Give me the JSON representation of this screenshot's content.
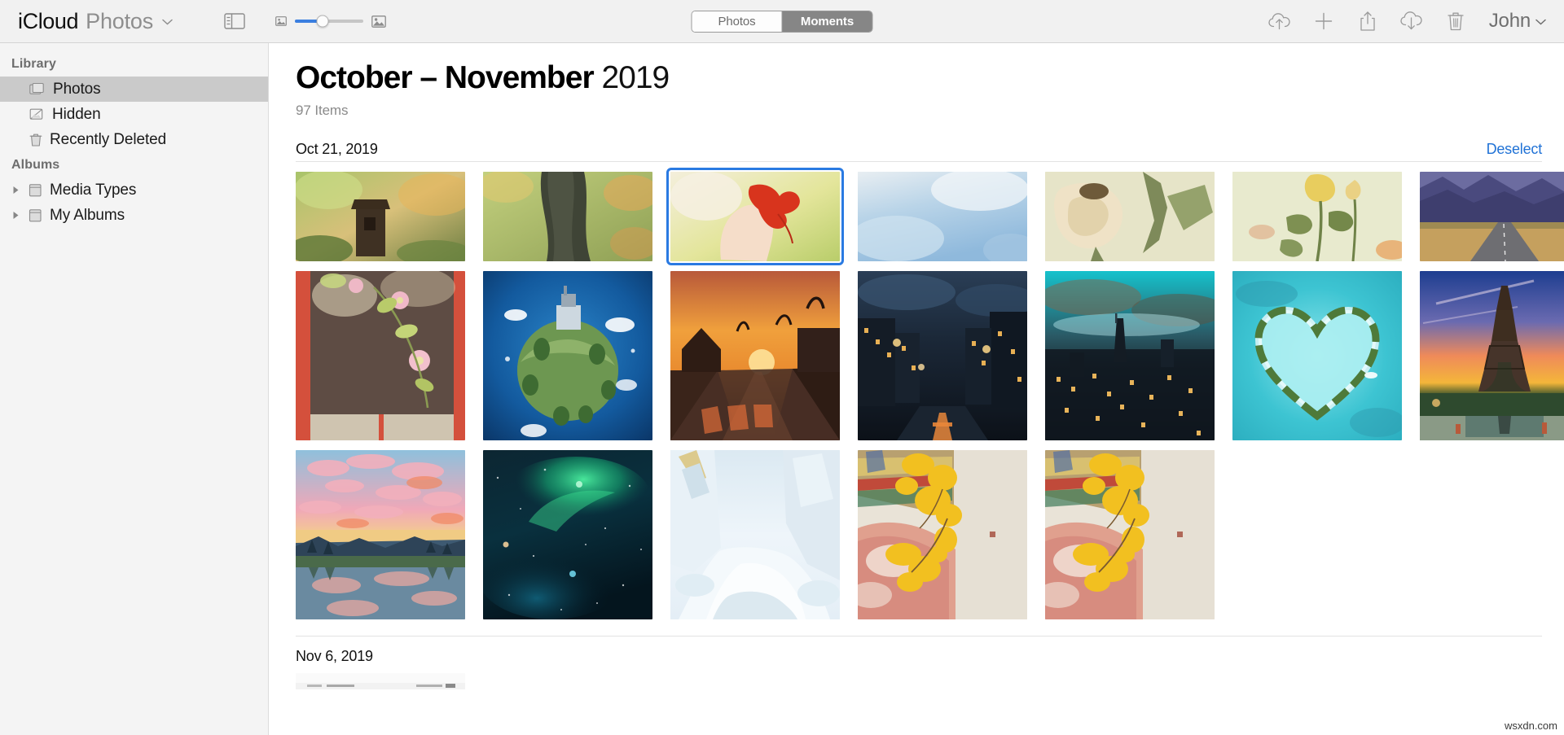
{
  "window": {
    "app_name_primary": "iCloud",
    "app_name_secondary": "Photos",
    "chevron": "⌄",
    "watermark": "wsxdn.com"
  },
  "toolbar": {
    "sidebar_toggle_name": "sidebar-toggle",
    "zoom_small_label": "small-thumbnails-icon",
    "zoom_large_label": "large-thumbnails-icon",
    "zoom_value_percent": 40,
    "segmented": {
      "options": [
        "Photos",
        "Moments"
      ],
      "selected": "Moments"
    },
    "actions": [
      {
        "name": "upload-icon",
        "label": "Upload"
      },
      {
        "name": "add-icon",
        "label": "Add"
      },
      {
        "name": "share-icon",
        "label": "Share"
      },
      {
        "name": "download-icon",
        "label": "Download"
      },
      {
        "name": "delete-icon",
        "label": "Delete"
      }
    ],
    "account": {
      "name": "John",
      "chevron": "⌄"
    }
  },
  "sidebar": {
    "groups": [
      {
        "title": "Library",
        "items": [
          {
            "label": "Photos",
            "icon": "photos-icon",
            "selected": true,
            "expandable": false
          },
          {
            "label": "Hidden",
            "icon": "hidden-icon",
            "selected": false,
            "expandable": false
          },
          {
            "label": "Recently Deleted",
            "icon": "trash-icon",
            "selected": false,
            "expandable": false
          }
        ]
      },
      {
        "title": "Albums",
        "items": [
          {
            "label": "Media Types",
            "icon": "album-icon",
            "selected": false,
            "expandable": true
          },
          {
            "label": "My Albums",
            "icon": "album-icon",
            "selected": false,
            "expandable": true
          }
        ]
      }
    ]
  },
  "main": {
    "title_bold": "October – November",
    "title_year": "2019",
    "item_count": "97 Items",
    "sections": [
      {
        "date": "Oct 21, 2019",
        "action_label": "Deselect",
        "rows": [
          {
            "orientation": "landscape",
            "photos": [
              {
                "alt": "wooden-birdhouse-autumn",
                "selected": false,
                "colors": [
                  "#8fae5a",
                  "#d8c07a",
                  "#6d5a3a",
                  "#3b2d1e"
                ]
              },
              {
                "alt": "autumn-leaves-tree-trunk",
                "selected": false,
                "colors": [
                  "#b9c878",
                  "#e0b877",
                  "#4e4a3a",
                  "#2f3224"
                ]
              },
              {
                "alt": "red-maple-leaf-in-hand",
                "selected": true,
                "colors": [
                  "#f3e3d2",
                  "#d93b22",
                  "#c9d37a",
                  "#f7d9c4"
                ]
              },
              {
                "alt": "soft-blue-sky-bokeh",
                "selected": false,
                "colors": [
                  "#cfe0ef",
                  "#9fc2df",
                  "#e8eef3",
                  "#b7d2e8"
                ]
              },
              {
                "alt": "dried-white-rose",
                "selected": false,
                "colors": [
                  "#efe6cf",
                  "#d9c9a4",
                  "#7e8a62",
                  "#b6a77f"
                ]
              },
              {
                "alt": "yellow-roses-wall",
                "selected": false,
                "colors": [
                  "#e6e7cf",
                  "#ead57a",
                  "#79894e",
                  "#c8cfa8"
                ]
              },
              {
                "alt": "desert-road-mountains",
                "selected": false,
                "colors": [
                  "#6a6a9e",
                  "#3d3f6b",
                  "#c9a75a",
                  "#8a8a8a"
                ]
              }
            ]
          },
          {
            "orientation": "portrait",
            "photos": [
              {
                "alt": "pink-blossoms-red-window",
                "selected": false,
                "colors": [
                  "#d4503c",
                  "#5e4c44",
                  "#e7d6b8",
                  "#9aa06a"
                ]
              },
              {
                "alt": "tiny-planet-castle",
                "selected": false,
                "colors": [
                  "#1463a8",
                  "#0d3f77",
                  "#6d9a59",
                  "#ffffff"
                ]
              },
              {
                "alt": "sunset-street-stop-sign",
                "selected": false,
                "colors": [
                  "#f2a03c",
                  "#8a3f22",
                  "#2b1c16",
                  "#d9722c"
                ]
              },
              {
                "alt": "night-city-street-lights",
                "selected": false,
                "colors": [
                  "#1d2633",
                  "#2e4356",
                  "#e0a84c",
                  "#0b0f14"
                ]
              },
              {
                "alt": "teal-city-skyline-dusk",
                "selected": false,
                "colors": [
                  "#11c0c8",
                  "#134049",
                  "#e8b24a",
                  "#0a1a20"
                ]
              },
              {
                "alt": "heart-shaped-island-lagoon",
                "selected": false,
                "colors": [
                  "#2fc6d4",
                  "#9fe8ec",
                  "#4d7a3a",
                  "#1b8fa0"
                ]
              },
              {
                "alt": "eiffel-tower-sunset",
                "selected": false,
                "colors": [
                  "#1b3d86",
                  "#f0a83a",
                  "#e86b5a",
                  "#2c2418"
                ]
              }
            ]
          },
          {
            "orientation": "portrait",
            "photos": [
              {
                "alt": "pink-clouds-lake-reflection",
                "selected": false,
                "colors": [
                  "#f0a0b4",
                  "#7fb2d8",
                  "#e8c46a",
                  "#1d3a4a"
                ]
              },
              {
                "alt": "green-aurora-night-sky",
                "selected": false,
                "colors": [
                  "#0a1f2e",
                  "#18d87e",
                  "#0d4a5a",
                  "#061018"
                ]
              },
              {
                "alt": "snow-covered-forest-path",
                "selected": false,
                "colors": [
                  "#e8f0f6",
                  "#ffffff",
                  "#c7d8e6",
                  "#d9b86a"
                ]
              },
              {
                "alt": "ginkgo-leaves-temple-wall",
                "selected": false,
                "colors": [
                  "#e8e2d6",
                  "#f0c020",
                  "#d98a7a",
                  "#8a7a4a"
                ]
              },
              {
                "alt": "ginkgo-leaves-temple-wall-2",
                "selected": false,
                "colors": [
                  "#e8e2d6",
                  "#f0c020",
                  "#d98a7a",
                  "#8a7a4a"
                ]
              }
            ]
          }
        ]
      },
      {
        "date": "Nov 6, 2019",
        "action_label": "",
        "rows": []
      }
    ]
  },
  "colors": {
    "accent_blue": "#2072d6",
    "selection_border": "#2a7ae2",
    "toolbar_bg": "#f1f1f1",
    "sidebar_bg": "#f4f4f4",
    "sidebar_selected": "#cacaca"
  }
}
